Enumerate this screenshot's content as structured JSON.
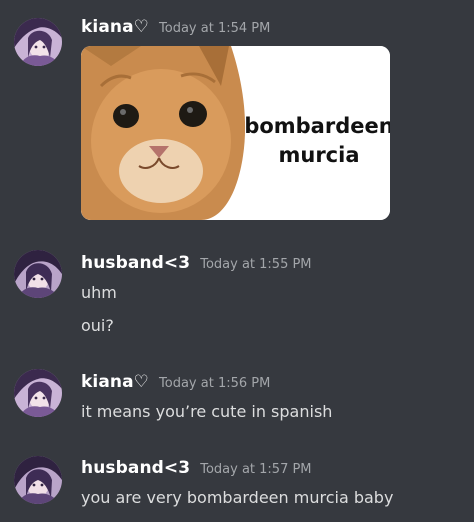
{
  "messages": [
    {
      "author": "kiana♡",
      "timestamp": "Today at 1:54 PM",
      "attachment": {
        "caption_line1": "bombardeen",
        "caption_line2": "murcia"
      }
    },
    {
      "author": "husband<3",
      "timestamp": "Today at 1:55 PM",
      "lines": [
        "uhm",
        "oui?"
      ]
    },
    {
      "author": "kiana♡",
      "timestamp": "Today at 1:56 PM",
      "lines": [
        "it means you’re cute in spanish"
      ]
    },
    {
      "author": "husband<3",
      "timestamp": "Today at 1:57 PM",
      "lines": [
        "you are very bombardeen murcia baby"
      ]
    }
  ],
  "colors": {
    "background": "#36393f",
    "username": "#ffffff",
    "timestamp": "#a3a6aa",
    "message_text": "#dcddde"
  }
}
